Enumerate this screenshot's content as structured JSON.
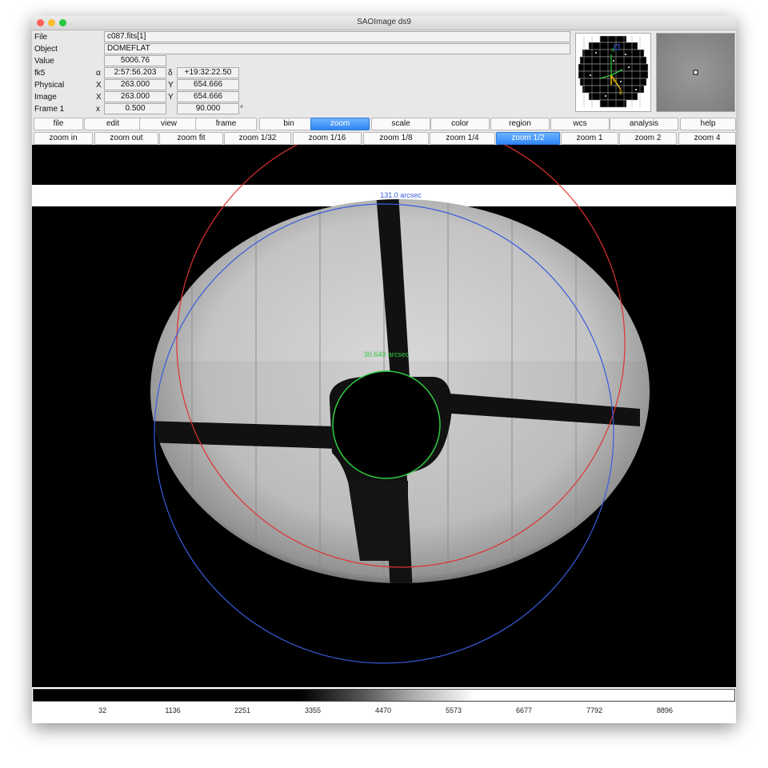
{
  "window": {
    "title": "SAOImage ds9"
  },
  "info": {
    "file_label": "File",
    "file_value": "c087.fits[1]",
    "object_label": "Object",
    "object_value": "DOMEFLAT",
    "value_label": "Value",
    "value_value": "5006.76",
    "fk5_label": "fk5",
    "alpha_symbol": "α",
    "alpha_value": "2:57:56.203",
    "delta_symbol": "δ",
    "delta_value": "+19:32:22.50",
    "physical_label": "Physical",
    "physical_x_label": "X",
    "physical_x": "263.000",
    "physical_y_label": "Y",
    "physical_y": "654.666",
    "image_label": "Image",
    "image_x_label": "X",
    "image_x": "263.000",
    "image_y_label": "Y",
    "image_y": "654.666",
    "frame_label": "Frame 1",
    "frame_x_label": "x",
    "frame_zoom": "0.500",
    "frame_angle": "90.000",
    "degree_symbol": "°"
  },
  "menu": [
    "file",
    "edit",
    "view",
    "frame",
    "bin",
    "zoom",
    "scale",
    "color",
    "region",
    "wcs",
    "analysis",
    "help"
  ],
  "menu_active": "zoom",
  "zoombar": [
    "zoom in",
    "zoom out",
    "zoom fit",
    "zoom 1/32",
    "zoom 1/16",
    "zoom 1/8",
    "zoom 1/4",
    "zoom 1/2",
    "zoom 1",
    "zoom 2",
    "zoom 4"
  ],
  "zoombar_active": "zoom 1/2",
  "regions": {
    "blue_label": "131.0 arcsec",
    "green_label": "30.640 arcsec",
    "blue_color": "#3b5bdb",
    "green_color": "#2ecc40",
    "red_color": "#e03131"
  },
  "colorbar": {
    "ticks": [
      "32",
      "1136",
      "2251",
      "3355",
      "4470",
      "5573",
      "6677",
      "7792",
      "8896"
    ]
  }
}
